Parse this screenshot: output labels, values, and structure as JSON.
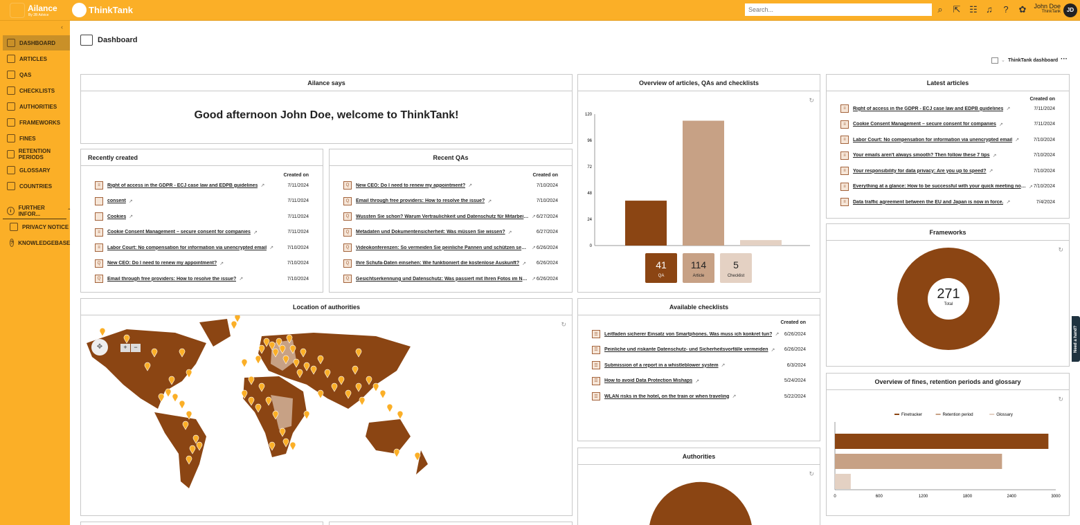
{
  "header": {
    "brand": "Ailance",
    "brand_sub": "By 2B Advice",
    "product": "ThinkTank",
    "search_placeholder": "Search...",
    "user_name": "John Doe",
    "user_org": "ThinkTank",
    "avatar_initials": "JD"
  },
  "colors": {
    "accent": "#FBAF27",
    "dark": "#8B4513",
    "mid": "#C7A185",
    "light": "#E4D1C3"
  },
  "sidebar": {
    "items": [
      {
        "label": "DASHBOARD",
        "icon": "dashboard-icon"
      },
      {
        "label": "ARTICLES",
        "icon": "article-icon"
      },
      {
        "label": "QAS",
        "icon": "qa-icon"
      },
      {
        "label": "CHECKLISTS",
        "icon": "checklist-icon"
      },
      {
        "label": "AUTHORITIES",
        "icon": "authority-icon"
      },
      {
        "label": "FRAMEWORKS",
        "icon": "framework-icon"
      },
      {
        "label": "FINES",
        "icon": "fines-icon"
      },
      {
        "label": "RETENTION PERIODS",
        "icon": "retention-icon"
      },
      {
        "label": "GLOSSARY",
        "icon": "glossary-icon"
      },
      {
        "label": "COUNTRIES",
        "icon": "globe-icon"
      }
    ],
    "further": "FURTHER INFOR...",
    "sub": [
      {
        "label": "PRIVACY NOTICE"
      },
      {
        "label": "KNOWLEDGEBASE"
      }
    ]
  },
  "page": {
    "title": "Dashboard",
    "dashboard_select": "ThinkTank dashboard",
    "more": "···",
    "help_tab": "Need a hand?"
  },
  "ailance": {
    "title": "Ailance says",
    "greeting": "Good afternoon John Doe, welcome to ThinkTank!"
  },
  "created_on": "Created on",
  "recently_created": {
    "title": "Recently created",
    "items": [
      {
        "type": "article",
        "title": "Right of access in the GDPR - ECJ case law and EDPB guidelines",
        "date": "7/11/2024"
      },
      {
        "type": "glossary",
        "title": "consent",
        "date": "7/11/2024"
      },
      {
        "type": "glossary",
        "title": "Cookies",
        "date": "7/11/2024"
      },
      {
        "type": "article",
        "title": "Cookie Consent Management – secure consent for companies",
        "date": "7/11/2024"
      },
      {
        "type": "article",
        "title": "Labor Court: No compensation for information via unencrypted email",
        "date": "7/10/2024"
      },
      {
        "type": "qa",
        "title": "New CEO: Do I need to renew my appointment?",
        "date": "7/10/2024"
      },
      {
        "type": "qa",
        "title": "Email through free providers: How to resolve the issue?",
        "date": "7/10/2024"
      }
    ]
  },
  "recent_qas": {
    "title": "Recent QAs",
    "items": [
      {
        "title": "New CEO: Do I need to renew my appointment?",
        "date": "7/10/2024"
      },
      {
        "title": "Email through free providers: How to resolve the issue?",
        "date": "7/10/2024"
      },
      {
        "title": "Wussten Sie schon? Warum Vertraulichkeit und Datenschutz für Mitarbeit...",
        "date": "6/27/2024"
      },
      {
        "title": "Metadaten und Dokumentensicherheit: Was müssen Sie wissen?",
        "date": "6/27/2024"
      },
      {
        "title": "Videokonferenzen: So vermeiden Sie peinliche Pannen und schützen sensi...",
        "date": "6/26/2024"
      },
      {
        "title": "Ihre Schufa-Daten einsehen: Wie funktioniert die kostenlose Auskunft?",
        "date": "6/26/2024"
      },
      {
        "title": "Gesichtserkennung und Datenschutz: Was passiert mit Ihren Fotos im Net...",
        "date": "6/26/2024"
      }
    ]
  },
  "overview": {
    "title": "Overview of articles, QAs and checklists"
  },
  "latest_articles": {
    "title": "Latest articles",
    "items": [
      {
        "title": "Right of access in the GDPR - ECJ case law and EDPB guidelines",
        "date": "7/11/2024"
      },
      {
        "title": "Cookie Consent Management – secure consent for companies",
        "date": "7/11/2024"
      },
      {
        "title": "Labor Court: No compensation for information via unencrypted email",
        "date": "7/10/2024"
      },
      {
        "title": "Your emails aren't always smooth? Then follow these 7 tips",
        "date": "7/10/2024"
      },
      {
        "title": "Your responsibility for data privacy: Are you up to speed?",
        "date": "7/10/2024"
      },
      {
        "title": "Everything at a glance: How to be successful with your quick meeting not...",
        "date": "7/10/2024"
      },
      {
        "title": "Data traffic agreement between the EU and Japan is now in force.",
        "date": "7/4/2024"
      }
    ]
  },
  "frameworks": {
    "title": "Frameworks",
    "total": "271",
    "total_label": "Total"
  },
  "checklists": {
    "title": "Available checklists",
    "items": [
      {
        "title": "Leitfaden sicherer Einsatz von Smartphones. Was muss ich konkret tun?",
        "date": "6/26/2024"
      },
      {
        "title": "Peinliche und riskante Datenschutz- und Sicherheitsvorfälle vermeiden",
        "date": "6/26/2024"
      },
      {
        "title": "Submission of a report in a whistleblower system",
        "date": "6/3/2024"
      },
      {
        "title": "How to avoid Data Protection Mishaps",
        "date": "5/24/2024"
      },
      {
        "title": "WLAN risks in the hotel, on the train or when traveling",
        "date": "5/22/2024"
      }
    ]
  },
  "authorities": {
    "title": "Authorities"
  },
  "location": {
    "title": "Location of authorities",
    "zoom_in": "+",
    "zoom_out": "−"
  },
  "fines_overview": {
    "title": "Overview of fines, retention periods and glossary"
  },
  "chart_data": [
    {
      "type": "bar",
      "title": "Overview of articles, QAs and checklists",
      "categories": [
        "QA",
        "Article",
        "Checklist"
      ],
      "values": [
        41,
        114,
        5
      ],
      "ylim": [
        0,
        120
      ],
      "yticks": [
        "0",
        "24",
        "48",
        "72",
        "96",
        "120"
      ]
    },
    {
      "type": "bar",
      "orientation": "horizontal",
      "title": "Overview of fines, retention periods and glossary",
      "series": [
        {
          "name": "Finetracker",
          "value": 2900
        },
        {
          "name": "Retention period",
          "value": 2270
        },
        {
          "name": "Glossary",
          "value": 215
        }
      ],
      "xlim": [
        0,
        3000
      ],
      "xticks": [
        "0",
        "600",
        "1200",
        "1800",
        "2400",
        "3000"
      ],
      "legend": "top"
    },
    {
      "type": "pie",
      "title": "Frameworks",
      "total": 271
    }
  ]
}
